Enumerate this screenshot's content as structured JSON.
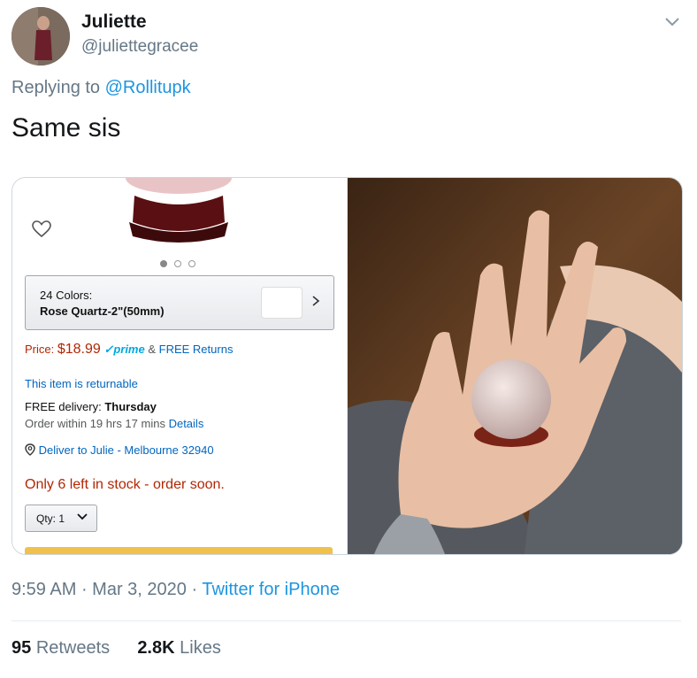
{
  "author": {
    "name": "Juliette",
    "handle": "@juliettegracee"
  },
  "reply": {
    "prefix": "Replying to",
    "to": "@Rollitupk"
  },
  "tweet": {
    "text": "Same sis"
  },
  "product": {
    "color_label": "24 Colors:",
    "color_value": "Rose Quartz-2\"(50mm)",
    "price_label": "Price:",
    "price_value": "$18.99",
    "prime": "✓prime",
    "returns": "FREE Returns",
    "returnable": "This item is returnable",
    "free_delivery_label": "FREE delivery:",
    "free_delivery_day": "Thursday",
    "order_within": "Order within 19 hrs 17 mins",
    "details": "Details",
    "deliver_to": "Deliver to Julie - Melbourne 32940",
    "stock": "Only 6 left in stock - order soon.",
    "qty": "Qty: 1"
  },
  "meta": {
    "time": "9:59 AM",
    "date": "Mar 3, 2020",
    "source": "Twitter for iPhone"
  },
  "stats": {
    "retweets_count": "95",
    "retweets_label": "Retweets",
    "likes_count": "2.8K",
    "likes_label": "Likes"
  },
  "colors": {
    "link": "#1b95e0",
    "price": "#B12704",
    "amazon_link": "#0066c0"
  }
}
